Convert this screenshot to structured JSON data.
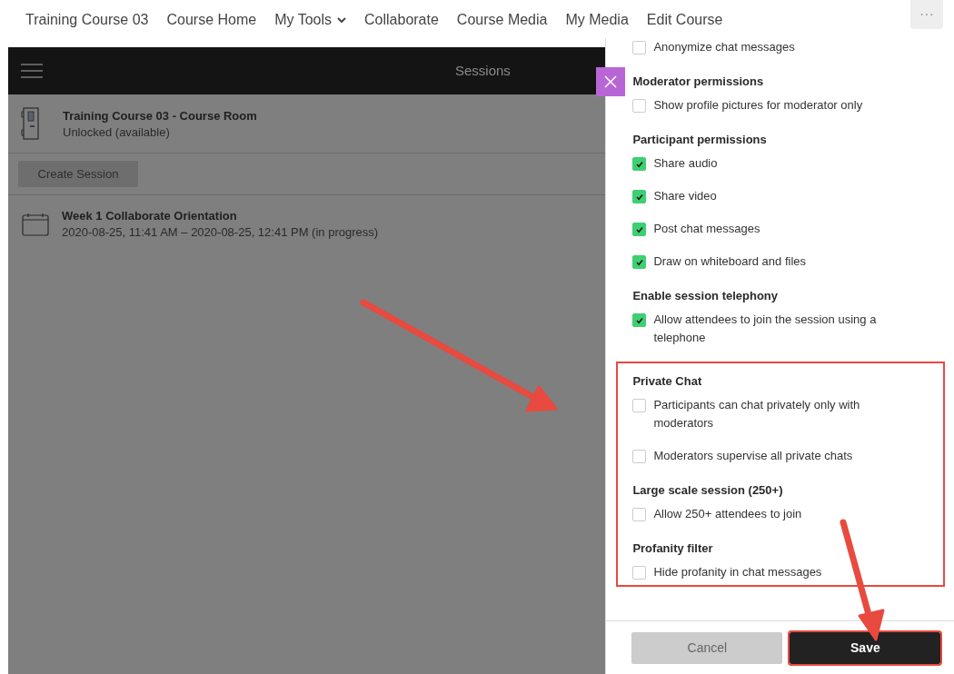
{
  "nav": {
    "items": [
      {
        "label": "Training Course 03",
        "dropdown": false
      },
      {
        "label": "Course Home",
        "dropdown": false
      },
      {
        "label": "My Tools",
        "dropdown": true
      },
      {
        "label": "Collaborate",
        "dropdown": false
      },
      {
        "label": "Course Media",
        "dropdown": false
      },
      {
        "label": "My Media",
        "dropdown": false
      },
      {
        "label": "Edit Course",
        "dropdown": false
      }
    ],
    "more_button": "···"
  },
  "sessions_panel": {
    "title": "Sessions",
    "room": {
      "title": "Training Course 03 - Course Room",
      "status": "Unlocked (available)"
    },
    "create_button": "Create Session",
    "sessions": [
      {
        "title": "Week 1 Collaborate Orientation",
        "time": "2020-08-25, 11:41 AM – 2020-08-25, 12:41 PM (in progress)"
      }
    ]
  },
  "settings_panel": {
    "sections": [
      {
        "options": [
          {
            "label": "Anonymize chat messages",
            "checked": false
          }
        ],
        "highlighted": false
      },
      {
        "heading": "Moderator permissions",
        "options": [
          {
            "label": "Show profile pictures for moderator only",
            "checked": false
          }
        ],
        "highlighted": false
      },
      {
        "heading": "Participant permissions",
        "options": [
          {
            "label": "Share audio",
            "checked": true
          },
          {
            "label": "Share video",
            "checked": true
          },
          {
            "label": "Post chat messages",
            "checked": true
          },
          {
            "label": "Draw on whiteboard and files",
            "checked": true
          }
        ],
        "highlighted": false
      },
      {
        "heading": "Enable session telephony",
        "options": [
          {
            "label": "Allow attendees to join the session using a telephone",
            "checked": true
          }
        ],
        "highlighted": false
      },
      {
        "heading": "Private Chat",
        "options": [
          {
            "label": "Participants can chat privately only with moderators",
            "checked": false
          },
          {
            "label": "Moderators supervise all private chats",
            "checked": false
          }
        ],
        "highlighted": true
      },
      {
        "heading": "Large scale session (250+)",
        "options": [
          {
            "label": "Allow 250+ attendees to join",
            "checked": false
          }
        ],
        "highlighted": true
      },
      {
        "heading": "Profanity filter",
        "options": [
          {
            "label": "Hide profanity in chat messages",
            "checked": false
          }
        ],
        "highlighted": true
      }
    ],
    "buttons": [
      {
        "label": "Cancel",
        "kind": "secondary",
        "highlighted": false
      },
      {
        "label": "Save",
        "kind": "primary",
        "highlighted": true
      }
    ]
  }
}
